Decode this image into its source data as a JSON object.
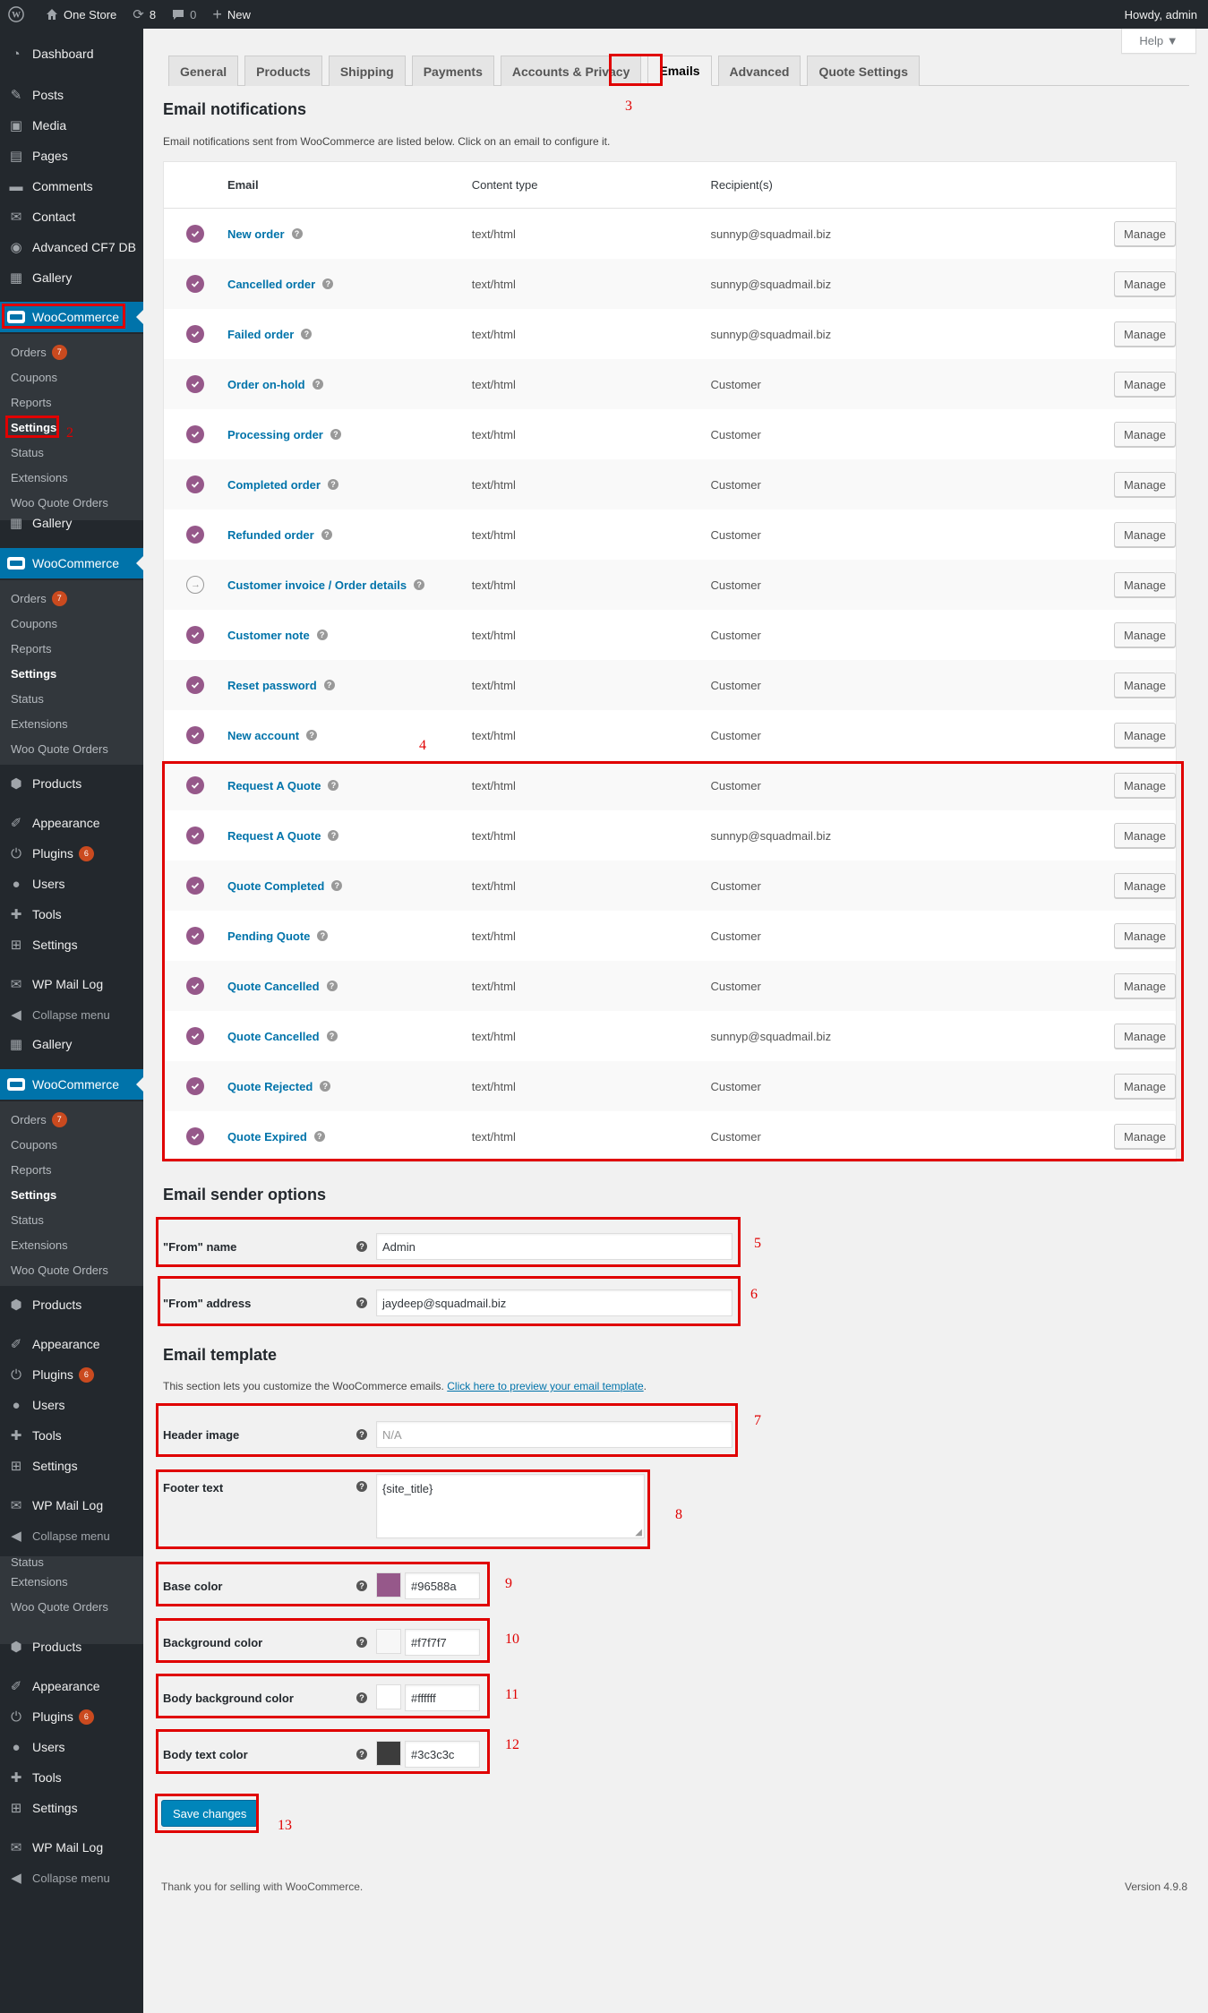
{
  "adminbar": {
    "site_name": "One Store",
    "updates_count": "8",
    "comments_count": "0",
    "new_label": "New",
    "howdy": "Howdy, admin"
  },
  "help_label": "Help ▼",
  "sidebar": {
    "top_items": [
      {
        "label": "Dashboard",
        "icon": "dashboard-icon"
      },
      {
        "label": "Posts",
        "icon": "pin-icon"
      },
      {
        "label": "Media",
        "icon": "media-icon"
      },
      {
        "label": "Pages",
        "icon": "page-icon"
      },
      {
        "label": "Comments",
        "icon": "comment-icon"
      },
      {
        "label": "Contact",
        "icon": "mail-icon"
      },
      {
        "label": "Advanced CF7 DB",
        "icon": "eye-icon"
      },
      {
        "label": "Gallery",
        "icon": "gallery-icon"
      }
    ],
    "woocommerce_label": "WooCommerce",
    "sub_items": [
      "Orders",
      "Coupons",
      "Reports",
      "Settings",
      "Status",
      "Extensions",
      "Woo Quote Orders"
    ],
    "orders_badge": "7",
    "gallery_label": "Gallery",
    "products_label": "Products",
    "bottom_items": [
      {
        "label": "Appearance",
        "icon": "brush-icon"
      },
      {
        "label": "Plugins",
        "icon": "plugin-icon",
        "badge": "6"
      },
      {
        "label": "Users",
        "icon": "user-icon"
      },
      {
        "label": "Tools",
        "icon": "wrench-icon"
      },
      {
        "label": "Settings",
        "icon": "settings-icon"
      }
    ],
    "mail_log_label": "WP Mail Log",
    "collapse_label": "Collapse menu",
    "status_label": "Status",
    "extensions_label": "Extensions",
    "woo_quote_label": "Woo Quote Orders"
  },
  "tabs": [
    "General",
    "Products",
    "Shipping",
    "Payments",
    "Accounts & Privacy",
    "Emails",
    "Advanced",
    "Quote Settings"
  ],
  "notifications": {
    "title": "Email notifications",
    "description": "Email notifications sent from WooCommerce are listed below. Click on an email to configure it.",
    "headers": {
      "email": "Email",
      "content_type": "Content type",
      "recipients": "Recipient(s)"
    },
    "manage_label": "Manage",
    "rows": [
      {
        "name": "New order",
        "type": "text/html",
        "recipient": "sunnyp@squadmail.biz",
        "status": "enabled"
      },
      {
        "name": "Cancelled order",
        "type": "text/html",
        "recipient": "sunnyp@squadmail.biz",
        "status": "enabled"
      },
      {
        "name": "Failed order",
        "type": "text/html",
        "recipient": "sunnyp@squadmail.biz",
        "status": "enabled"
      },
      {
        "name": "Order on-hold",
        "type": "text/html",
        "recipient": "Customer",
        "status": "enabled"
      },
      {
        "name": "Processing order",
        "type": "text/html",
        "recipient": "Customer",
        "status": "enabled"
      },
      {
        "name": "Completed order",
        "type": "text/html",
        "recipient": "Customer",
        "status": "enabled"
      },
      {
        "name": "Refunded order",
        "type": "text/html",
        "recipient": "Customer",
        "status": "enabled"
      },
      {
        "name": "Customer invoice / Order details",
        "type": "text/html",
        "recipient": "Customer",
        "status": "manual"
      },
      {
        "name": "Customer note",
        "type": "text/html",
        "recipient": "Customer",
        "status": "enabled"
      },
      {
        "name": "Reset password",
        "type": "text/html",
        "recipient": "Customer",
        "status": "enabled"
      },
      {
        "name": "New account",
        "type": "text/html",
        "recipient": "Customer",
        "status": "enabled"
      },
      {
        "name": "Request A Quote",
        "type": "text/html",
        "recipient": "Customer",
        "status": "enabled"
      },
      {
        "name": "Request A Quote",
        "type": "text/html",
        "recipient": "sunnyp@squadmail.biz",
        "status": "enabled"
      },
      {
        "name": "Quote Completed",
        "type": "text/html",
        "recipient": "Customer",
        "status": "enabled"
      },
      {
        "name": "Pending Quote",
        "type": "text/html",
        "recipient": "Customer",
        "status": "enabled"
      },
      {
        "name": "Quote Cancelled",
        "type": "text/html",
        "recipient": "Customer",
        "status": "enabled"
      },
      {
        "name": "Quote Cancelled",
        "type": "text/html",
        "recipient": "sunnyp@squadmail.biz",
        "status": "enabled"
      },
      {
        "name": "Quote Rejected",
        "type": "text/html",
        "recipient": "Customer",
        "status": "enabled"
      },
      {
        "name": "Quote Expired",
        "type": "text/html",
        "recipient": "Customer",
        "status": "enabled"
      }
    ]
  },
  "sender": {
    "title": "Email sender options",
    "from_name_label": "\"From\" name",
    "from_name_value": "Admin",
    "from_address_label": "\"From\" address",
    "from_address_value": "jaydeep@squadmail.biz"
  },
  "template": {
    "title": "Email template",
    "description": "This section lets you customize the WooCommerce emails.",
    "preview_link": "Click here to preview your email template",
    "header_image_label": "Header image",
    "header_image_placeholder": "N/A",
    "footer_text_label": "Footer text",
    "footer_text_value": "{site_title}",
    "base_color_label": "Base color",
    "base_color_value": "#96588a",
    "bg_color_label": "Background color",
    "bg_color_value": "#f7f7f7",
    "body_bg_color_label": "Body background color",
    "body_bg_color_value": "#ffffff",
    "body_text_color_label": "Body text color",
    "body_text_color_value": "#3c3c3c"
  },
  "save_label": "Save changes",
  "footer": {
    "thanks": "Thank you for selling with WooCommerce.",
    "version": "Version 4.9.8"
  },
  "annotations": [
    "2",
    "3",
    "4",
    "5",
    "6",
    "7",
    "8",
    "9",
    "10",
    "11",
    "12",
    "13"
  ]
}
